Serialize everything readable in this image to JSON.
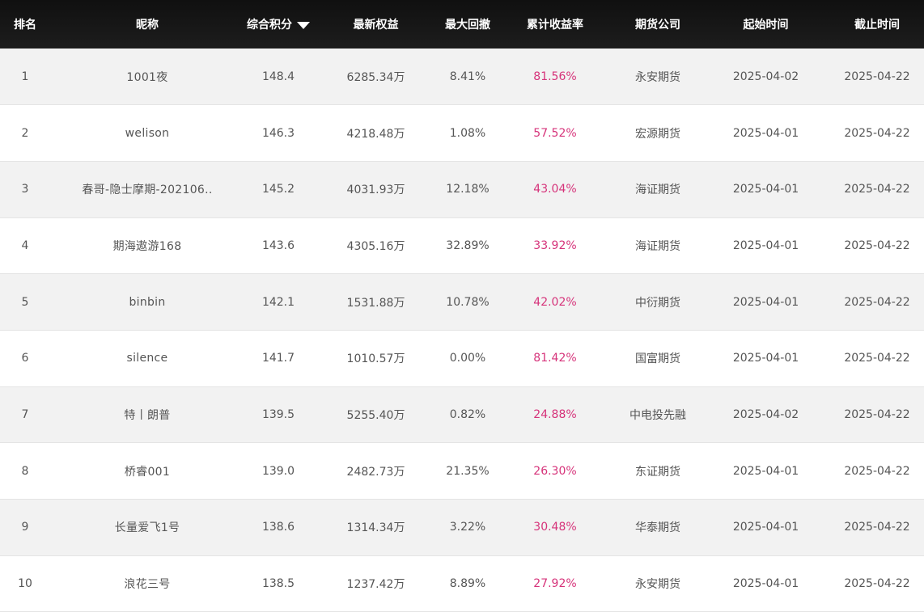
{
  "columns": [
    "排名",
    "昵称",
    "综合积分",
    "最新权益",
    "最大回撤",
    "累计收益率",
    "期货公司",
    "起始时间",
    "截止时间"
  ],
  "rows": [
    {
      "rank": "1",
      "nick": "1001夜",
      "score": "148.4",
      "equity": "6285.34万",
      "drawdown": "8.41%",
      "ret": "81.56%",
      "company": "永安期货",
      "start": "2025-04-02",
      "end": "2025-04-22"
    },
    {
      "rank": "2",
      "nick": "welison",
      "score": "146.3",
      "equity": "4218.48万",
      "drawdown": "1.08%",
      "ret": "57.52%",
      "company": "宏源期货",
      "start": "2025-04-01",
      "end": "2025-04-22"
    },
    {
      "rank": "3",
      "nick": "春哥-隐士摩期-202106..",
      "score": "145.2",
      "equity": "4031.93万",
      "drawdown": "12.18%",
      "ret": "43.04%",
      "company": "海证期货",
      "start": "2025-04-01",
      "end": "2025-04-22"
    },
    {
      "rank": "4",
      "nick": "期海遨游168",
      "score": "143.6",
      "equity": "4305.16万",
      "drawdown": "32.89%",
      "ret": "33.92%",
      "company": "海证期货",
      "start": "2025-04-01",
      "end": "2025-04-22"
    },
    {
      "rank": "5",
      "nick": "binbin",
      "score": "142.1",
      "equity": "1531.88万",
      "drawdown": "10.78%",
      "ret": "42.02%",
      "company": "中衍期货",
      "start": "2025-04-01",
      "end": "2025-04-22"
    },
    {
      "rank": "6",
      "nick": "silence",
      "score": "141.7",
      "equity": "1010.57万",
      "drawdown": "0.00%",
      "ret": "81.42%",
      "company": "国富期货",
      "start": "2025-04-01",
      "end": "2025-04-22"
    },
    {
      "rank": "7",
      "nick": "特丨朗普",
      "score": "139.5",
      "equity": "5255.40万",
      "drawdown": "0.82%",
      "ret": "24.88%",
      "company": "中电投先融",
      "start": "2025-04-02",
      "end": "2025-04-22"
    },
    {
      "rank": "8",
      "nick": "桥睿001",
      "score": "139.0",
      "equity": "2482.73万",
      "drawdown": "21.35%",
      "ret": "26.30%",
      "company": "东证期货",
      "start": "2025-04-01",
      "end": "2025-04-22"
    },
    {
      "rank": "9",
      "nick": "长量爱飞1号",
      "score": "138.6",
      "equity": "1314.34万",
      "drawdown": "3.22%",
      "ret": "30.48%",
      "company": "华泰期货",
      "start": "2025-04-01",
      "end": "2025-04-22"
    },
    {
      "rank": "10",
      "nick": "浪花三号",
      "score": "138.5",
      "equity": "1237.42万",
      "drawdown": "8.89%",
      "ret": "27.92%",
      "company": "永安期货",
      "start": "2025-04-01",
      "end": "2025-04-22"
    }
  ],
  "sort": {
    "column": "综合积分",
    "direction": "desc",
    "icon": "caret-down-icon"
  },
  "colors": {
    "header_bg": "#161616",
    "return_text": "#d6337a",
    "row_alt": "#f2f2f2",
    "text": "#555555"
  }
}
